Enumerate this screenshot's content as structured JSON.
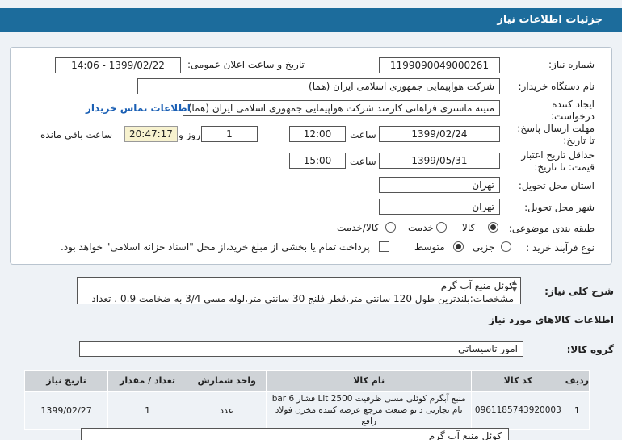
{
  "page_title": "جزئیات اطلاعات نیاز",
  "fields": {
    "need_number_label": "شماره نیاز:",
    "need_number": "1199090049000261",
    "announce_label": "تاریخ و ساعت اعلان عمومی:",
    "announce_value": "1399/02/22 - 14:06",
    "buyer_org_label": "نام دستگاه خریدار:",
    "buyer_org": "شرکت هواپیمایی جمهوری اسلامی ایران (هما)",
    "creator_label": "ایجاد کننده درخواست:",
    "creator": "متینه ماستری فراهانی کارمند شرکت هواپیمایی جمهوری اسلامی ایران (هما)",
    "contact_link": "اطلاعات تماس خریدار",
    "deadline_label": "مهلت ارسال پاسخ: تا تاریخ:",
    "deadline_date": "1399/02/24",
    "time_label": "ساعت",
    "deadline_time": "12:00",
    "day_label": "روز و",
    "days_value": "1",
    "remaining_time": "20:47:17",
    "remaining_label": "ساعت باقی مانده",
    "validity_label": "حداقل تاریخ اعتبار قیمت: تا تاریخ:",
    "validity_date": "1399/05/31",
    "validity_time": "15:00",
    "province_label": "استان محل تحویل:",
    "province": "تهران",
    "city_label": "شهر محل تحویل:",
    "city": "تهران",
    "category_label": "طبقه بندی موضوعی:",
    "category_options": [
      "کالا",
      "خدمت",
      "کالا/خدمت"
    ],
    "purchase_type_label": "نوع فرآیند خرید :",
    "purchase_options": [
      "جزیی",
      "متوسط"
    ],
    "treasury_note": "پرداخت تمام یا بخشی از مبلغ خرید،از محل \"اسناد خزانه اسلامی\" خواهد بود."
  },
  "description": {
    "label": "شرح کلی نیاز:",
    "line1": "کوئل منبع آب گرم",
    "line2": "مشخصات:بلندترین طول 120 سانتی متر،قطر فلنج 30 سانتی متر،لوله مسی 3/4 به ضخامت 0.9 ، تعداد"
  },
  "goods_section_title": "اطلاعات کالاهای مورد نیاز",
  "goods_group_label": "گروه کالا:",
  "goods_group": "امور تاسیساتی",
  "table": {
    "headers": [
      "ردیف",
      "کد کالا",
      "نام کالا",
      "واحد شمارش",
      "تعداد / مقدار",
      "تاریخ نیاز"
    ],
    "rows": [
      {
        "row": "1",
        "code": "0961185743920003",
        "name": "منبع آبگرم کوئلی مسی ظرفیت 2500 Lit فشار 6 bar نام تجارتی دانو صنعت مرجع عرضه کننده مخزن فولاد رافع",
        "unit": "عدد",
        "qty": "1",
        "date": "1399/02/27"
      }
    ]
  },
  "bottom_text": "کوئل منبع آب گرم"
}
